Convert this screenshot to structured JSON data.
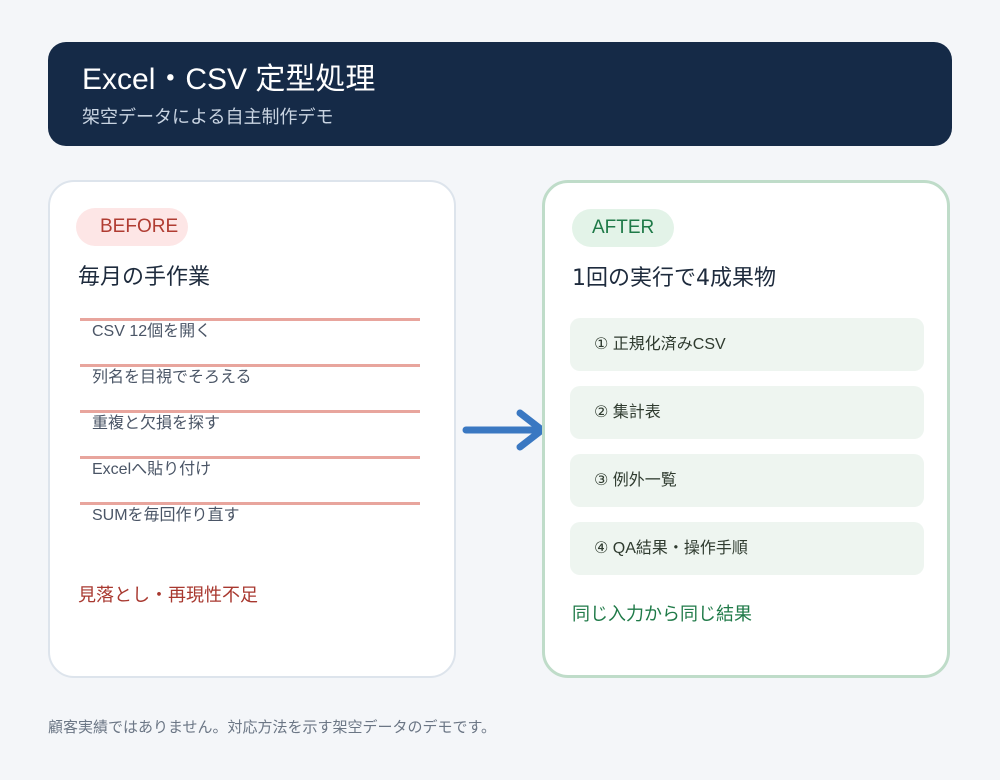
{
  "header": {
    "title": "Excel・CSV 定型処理",
    "subtitle": "架空データによる自主制作デモ"
  },
  "before": {
    "badge": "BEFORE",
    "heading": "毎月の手作業",
    "items": [
      "CSV 12個を開く",
      "列名を目視でそろえる",
      "重複と欠損を探す",
      "Excelへ貼り付け",
      "SUMを毎回作り直す"
    ],
    "footer": "見落とし・再現性不足"
  },
  "after": {
    "badge": "AFTER",
    "heading": "1回の実行で4成果物",
    "items": [
      "① 正規化済みCSV",
      "② 集計表",
      "③ 例外一覧",
      "④ QA結果・操作手順"
    ],
    "footer": "同じ入力から同じ結果"
  },
  "arrow_icon": "arrow-right-icon",
  "footnote": "顧客実績ではありません。対応方法を示す架空データのデモです。",
  "colors": {
    "header_bg": "#152a47",
    "before_accent": "#b03c32",
    "before_rule": "#e8a59d",
    "after_accent": "#1f7a48",
    "after_border": "#bfdcc9",
    "arrow": "#3a78c2"
  }
}
